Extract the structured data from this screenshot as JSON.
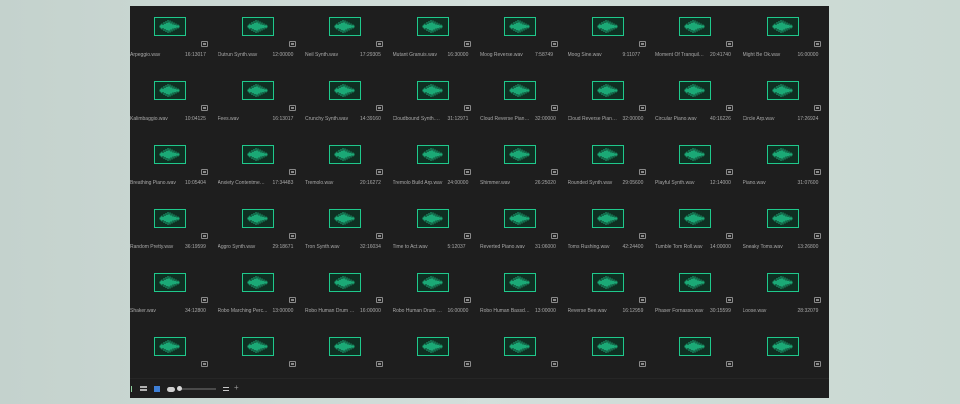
{
  "bin": {
    "items": [
      {
        "name": "Arpeggio.wav",
        "duration": "16:13017"
      },
      {
        "name": "Outrun Synth.wav",
        "duration": "12:00000"
      },
      {
        "name": "Neil Synth.wav",
        "duration": "17:29305"
      },
      {
        "name": "Mutant Granuis.wav",
        "duration": "16:30000"
      },
      {
        "name": "Moog Reverse.wav",
        "duration": "7:58749"
      },
      {
        "name": "Moog Sine.wav",
        "duration": "9:11077"
      },
      {
        "name": "Moment Of Tranquility....",
        "duration": "20:41740"
      },
      {
        "name": "Might Be Ok.wav",
        "duration": "16:00000"
      },
      {
        "name": "Kalimbaggio.wav",
        "duration": "10:04125"
      },
      {
        "name": "Fees.wav",
        "duration": "16:13017"
      },
      {
        "name": "Crunchy Synth.wav",
        "duration": "14:39160"
      },
      {
        "name": "Cloudbound Synth.wav",
        "duration": "31:12971"
      },
      {
        "name": "Cloud Reverse Piano...",
        "duration": "32:00000"
      },
      {
        "name": "Cloud Reverse Piano 2...",
        "duration": "32:00000"
      },
      {
        "name": "Circular Piano.wav",
        "duration": "40:16226"
      },
      {
        "name": "Circle Arp.wav",
        "duration": "17:26924"
      },
      {
        "name": "Breathing Piano.wav",
        "duration": "10:05404"
      },
      {
        "name": "Anxiety Contentment...",
        "duration": "17:34483"
      },
      {
        "name": "Tremolo.wav",
        "duration": "20:16272"
      },
      {
        "name": "Tremolo Build Arp.wav",
        "duration": "24:00000"
      },
      {
        "name": "Shimmer.wav",
        "duration": "26:25020"
      },
      {
        "name": "Rounded Synth.wav",
        "duration": "29:05600"
      },
      {
        "name": "Playful Synth.wav",
        "duration": "12:14000"
      },
      {
        "name": "Piano.wav",
        "duration": "31:07600"
      },
      {
        "name": "Random Pretty.wav",
        "duration": "36:19599"
      },
      {
        "name": "Aggro Synth.wav",
        "duration": "29:18671"
      },
      {
        "name": "Tron Synth.wav",
        "duration": "32:16034"
      },
      {
        "name": "Time to Act.wav",
        "duration": "5:12037"
      },
      {
        "name": "Reverted Piano.wav",
        "duration": "31:06000"
      },
      {
        "name": "Toms Rushing.wav",
        "duration": "42:24400"
      },
      {
        "name": "Tumble Tom Roll.wav",
        "duration": "14:00000"
      },
      {
        "name": "Sneaky Toms.wav",
        "duration": "13:26800"
      },
      {
        "name": "Shaker.wav",
        "duration": "34:12800"
      },
      {
        "name": "Robo Marching Perc...",
        "duration": "13:00000"
      },
      {
        "name": "Robo Human Drum S...",
        "duration": "16:00000"
      },
      {
        "name": "Robo Human Drum B...",
        "duration": "16:00000"
      },
      {
        "name": "Robo Human Bassdr...",
        "duration": "13:00000"
      },
      {
        "name": "Reverse Bee.wav",
        "duration": "16:12959"
      },
      {
        "name": "Phaser Fornasso.wav",
        "duration": "30:15599"
      },
      {
        "name": "Loose.wav",
        "duration": "28:32079"
      },
      {
        "name": "",
        "duration": ""
      },
      {
        "name": "",
        "duration": ""
      },
      {
        "name": "",
        "duration": ""
      },
      {
        "name": "",
        "duration": ""
      },
      {
        "name": "",
        "duration": ""
      },
      {
        "name": "",
        "duration": ""
      },
      {
        "name": "",
        "duration": ""
      },
      {
        "name": "",
        "duration": ""
      }
    ]
  },
  "statusbar": {
    "icons": [
      "list-view-icon",
      "icon-view-icon",
      "freeform-view-icon",
      "sort-icon",
      "meta-icon",
      "new-bin-icon"
    ],
    "zoom_value": 0.0,
    "new_bin_glyph": "+"
  },
  "colors": {
    "waveform": "#1fc98c",
    "thumb_bg": "#0f2f22",
    "panel_bg": "#1e1e1e",
    "text": "#a9a9a9"
  }
}
